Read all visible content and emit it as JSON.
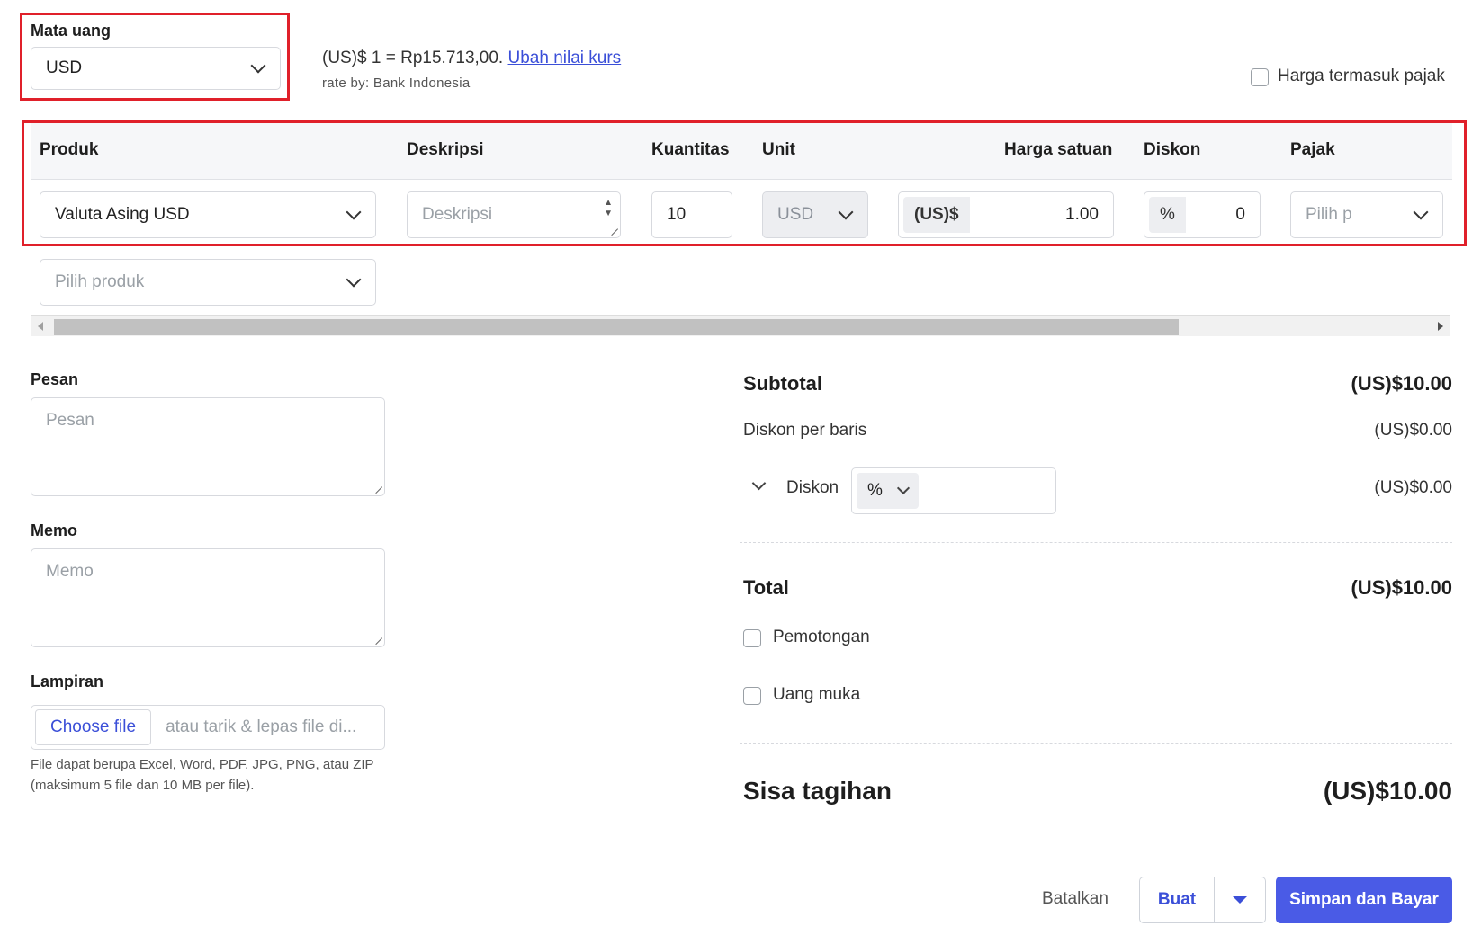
{
  "currency": {
    "label": "Mata uang",
    "selected": "USD",
    "rate_text": "(US)$ 1 = Rp15.713,00.",
    "change_rate_link": "Ubah nilai kurs",
    "rate_by": "rate by: Bank Indonesia"
  },
  "tax_inclusive": {
    "label": "Harga termasuk pajak",
    "checked": false
  },
  "table": {
    "headers": {
      "product": "Produk",
      "description": "Deskripsi",
      "quantity": "Kuantitas",
      "unit": "Unit",
      "unit_price": "Harga satuan",
      "discount": "Diskon",
      "tax": "Pajak"
    },
    "row": {
      "product": "Valuta Asing USD",
      "description_placeholder": "Deskripsi",
      "quantity": "10",
      "unit": "USD",
      "price_prefix": "(US)$",
      "price": "1.00",
      "discount_prefix": "%",
      "discount": "0",
      "tax_placeholder": "Pilih p"
    },
    "add_product_placeholder": "Pilih produk"
  },
  "message": {
    "label": "Pesan",
    "placeholder": "Pesan"
  },
  "memo": {
    "label": "Memo",
    "placeholder": "Memo"
  },
  "attachment": {
    "label": "Lampiran",
    "choose_button": "Choose file",
    "drop_text": "atau tarik & lepas file di...",
    "help_line1": "File dapat berupa Excel, Word, PDF, JPG, PNG, atau ZIP",
    "help_line2": "(maksimum 5 file dan 10 MB per file)."
  },
  "summary": {
    "subtotal_label": "Subtotal",
    "subtotal_value": "(US)$10.00",
    "line_discount_label": "Diskon per baris",
    "line_discount_value": "(US)$0.00",
    "discount_label": "Diskon",
    "discount_type": "%",
    "discount_value": "(US)$0.00",
    "total_label": "Total",
    "total_value": "(US)$10.00",
    "deduction_label": "Pemotongan",
    "deposit_label": "Uang muka",
    "balance_label": "Sisa tagihan",
    "balance_value": "(US)$10.00"
  },
  "actions": {
    "cancel": "Batalkan",
    "create": "Buat",
    "save_and_pay": "Simpan dan Bayar"
  },
  "colors": {
    "highlight": "#e0202a",
    "primary": "#4a5be6",
    "link": "#3b4fd8"
  }
}
